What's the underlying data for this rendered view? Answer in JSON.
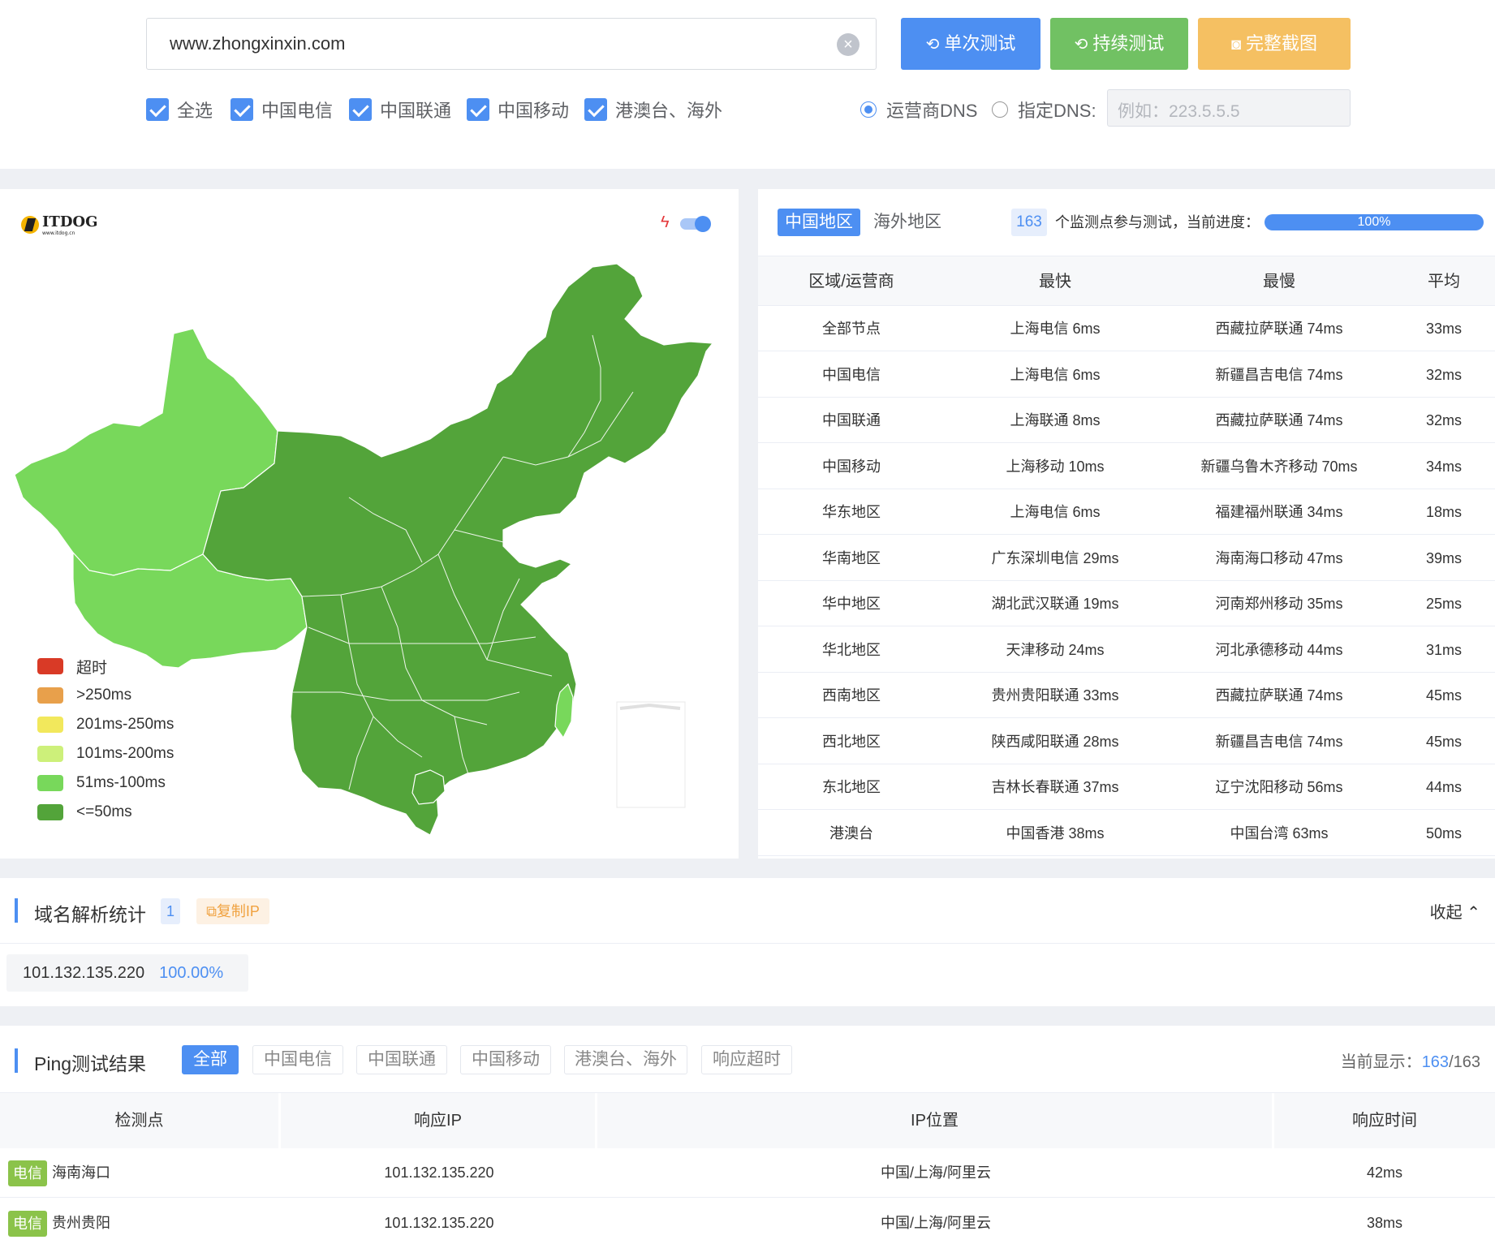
{
  "search": {
    "url_value": "www.zhongxinxin.com",
    "buttons": {
      "single": "单次测试",
      "continuous": "持续测试",
      "screenshot": "完整截图"
    }
  },
  "filters": {
    "checkboxes": [
      "全选",
      "中国电信",
      "中国联通",
      "中国移动",
      "港澳台、海外"
    ],
    "dns": {
      "carrier": "运营商DNS",
      "custom": "指定DNS:",
      "custom_placeholder": "例如：223.5.5.5"
    }
  },
  "map": {
    "logo_text": "ITDOG",
    "logo_sub": "www.itdog.cn",
    "legend": [
      {
        "label": "超时",
        "color": "#d93a26"
      },
      {
        "label": ">250ms",
        "color": "#e8a04b"
      },
      {
        "label": "201ms-250ms",
        "color": "#f2e85c"
      },
      {
        "label": "101ms-200ms",
        "color": "#cdf07a"
      },
      {
        "label": "51ms-100ms",
        "color": "#78d85b"
      },
      {
        "label": "<=50ms",
        "color": "#53a43a"
      }
    ]
  },
  "stats": {
    "tab_china": "中国地区",
    "tab_overseas": "海外地区",
    "node_count": "163",
    "count_text": "个监测点参与测试，当前进度：",
    "progress": "100%",
    "headers": [
      "区域/运营商",
      "最快",
      "最慢",
      "平均"
    ],
    "rows": [
      [
        "全部节点",
        "上海电信 6ms",
        "西藏拉萨联通 74ms",
        "33ms"
      ],
      [
        "中国电信",
        "上海电信 6ms",
        "新疆昌吉电信 74ms",
        "32ms"
      ],
      [
        "中国联通",
        "上海联通 8ms",
        "西藏拉萨联通 74ms",
        "32ms"
      ],
      [
        "中国移动",
        "上海移动 10ms",
        "新疆乌鲁木齐移动 70ms",
        "34ms"
      ],
      [
        "华东地区",
        "上海电信 6ms",
        "福建福州联通 34ms",
        "18ms"
      ],
      [
        "华南地区",
        "广东深圳电信 29ms",
        "海南海口移动 47ms",
        "39ms"
      ],
      [
        "华中地区",
        "湖北武汉联通 19ms",
        "河南郑州移动 35ms",
        "25ms"
      ],
      [
        "华北地区",
        "天津移动 24ms",
        "河北承德移动 44ms",
        "31ms"
      ],
      [
        "西南地区",
        "贵州贵阳联通 33ms",
        "西藏拉萨联通 74ms",
        "45ms"
      ],
      [
        "西北地区",
        "陕西咸阳联通 28ms",
        "新疆昌吉电信 74ms",
        "45ms"
      ],
      [
        "东北地区",
        "吉林长春联通 37ms",
        "辽宁沈阳移动 56ms",
        "44ms"
      ],
      [
        "港澳台",
        "中国香港 38ms",
        "中国台湾 63ms",
        "50ms"
      ]
    ]
  },
  "dns_stats": {
    "title": "域名解析统计",
    "count": "1",
    "copy": "复制IP",
    "collapse": "收起",
    "ip": "101.132.135.220",
    "pct": "100.00%"
  },
  "ping": {
    "title": "Ping测试结果",
    "tabs": [
      "全部",
      "中国电信",
      "中国联通",
      "中国移动",
      "港澳台、海外",
      "响应超时"
    ],
    "count_label": "当前显示：",
    "count_shown": "163",
    "count_total": "/163",
    "headers": [
      "检测点",
      "响应IP",
      "IP位置",
      "响应时间"
    ],
    "rows": [
      {
        "isp": "电信",
        "node": "海南海口",
        "ip": "101.132.135.220",
        "loc": "中国/上海/阿里云",
        "time": "42ms"
      },
      {
        "isp": "电信",
        "node": "贵州贵阳",
        "ip": "101.132.135.220",
        "loc": "中国/上海/阿里云",
        "time": "38ms"
      }
    ]
  }
}
